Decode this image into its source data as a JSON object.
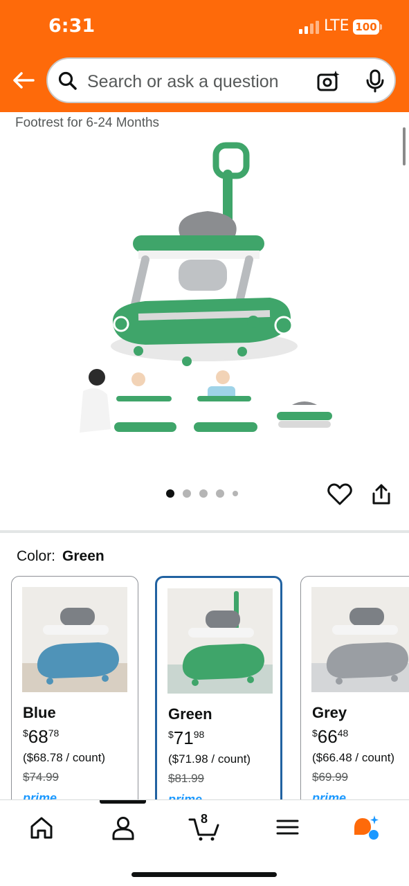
{
  "status_bar": {
    "time": "6:31",
    "network": "LTE",
    "battery": "100"
  },
  "search": {
    "placeholder": "Search or ask a question"
  },
  "product": {
    "title_fragment": "Footrest for 6-24 Months",
    "image_count": 5,
    "active_image_index": 0
  },
  "color_selector": {
    "label": "Color:",
    "selected": "Green"
  },
  "variants": [
    {
      "name": "Blue",
      "price_currency": "$",
      "price_whole": "68",
      "price_fraction": "78",
      "unit_price": "($68.78 / count)",
      "list_price": "$74.99",
      "prime": "prime",
      "color": "#4f93b8",
      "selected": false
    },
    {
      "name": "Green",
      "price_currency": "$",
      "price_whole": "71",
      "price_fraction": "98",
      "unit_price": "($71.98 / count)",
      "list_price": "$81.99",
      "prime": "prime",
      "color": "#3fa56a",
      "selected": true
    },
    {
      "name": "Grey",
      "price_currency": "$",
      "price_whole": "66",
      "price_fraction": "48",
      "unit_price": "($66.48 / count)",
      "list_price": "$69.99",
      "prime": "prime",
      "color": "#9a9ea3",
      "selected": false
    }
  ],
  "bottom_nav": {
    "cart_count": "8",
    "items": [
      "home-icon",
      "account-icon",
      "cart-icon",
      "menu-icon",
      "rufus-icon"
    ]
  },
  "colors": {
    "header": "#fe6a0a",
    "selected_border": "#2162a1",
    "walker_green": "#3fa56a"
  }
}
